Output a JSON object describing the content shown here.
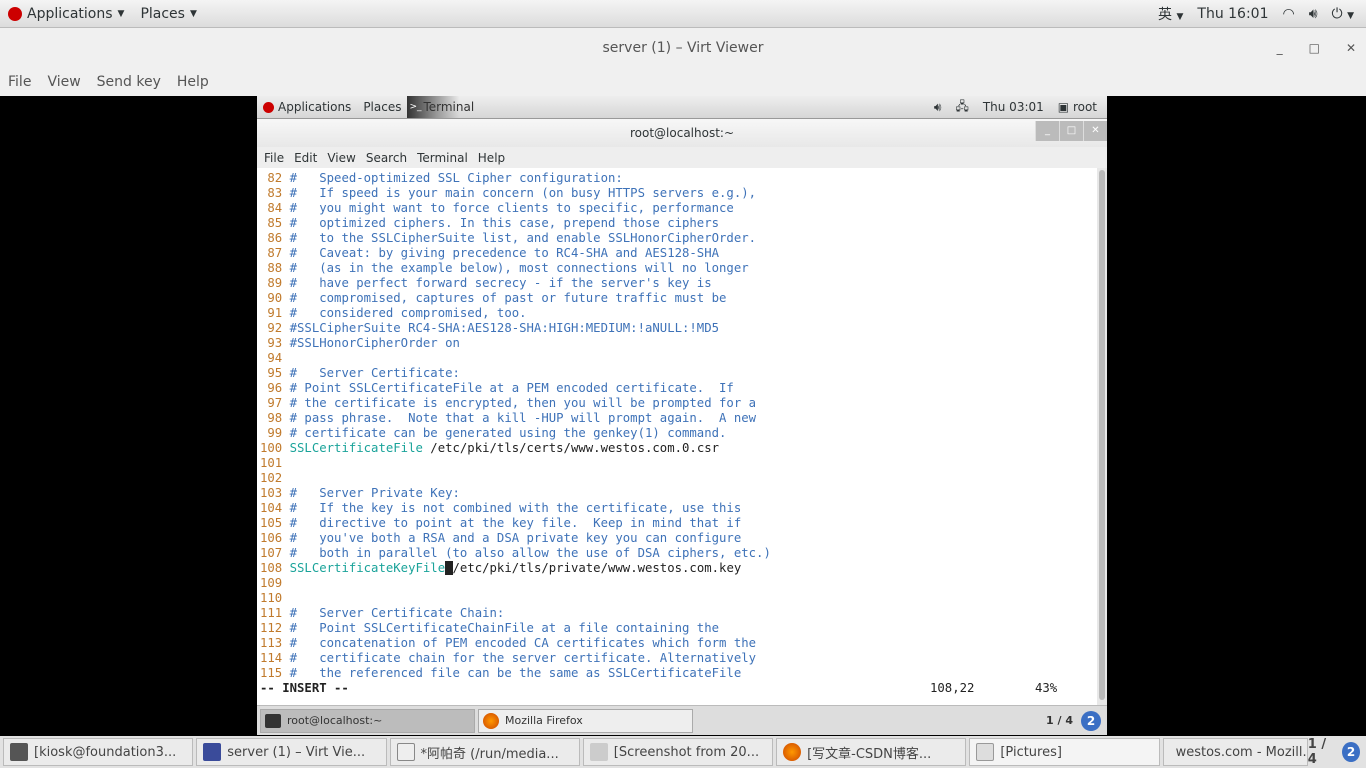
{
  "host_topbar": {
    "applications": "Applications",
    "places": "Places",
    "input_method": "英",
    "clock": "Thu 16:01"
  },
  "viewer": {
    "title": "server (1) – Virt Viewer",
    "menu": [
      "File",
      "View",
      "Send key",
      "Help"
    ]
  },
  "guest_topbar": {
    "applications": "Applications",
    "places": "Places",
    "terminal": "Terminal",
    "clock": "Thu 03:01",
    "user": "root"
  },
  "terminal": {
    "title": "root@localhost:~",
    "menu": [
      "File",
      "Edit",
      "View",
      "Search",
      "Terminal",
      "Help"
    ]
  },
  "lines": [
    {
      "n": "82",
      "c": "#   Speed-optimized SSL Cipher configuration:"
    },
    {
      "n": "83",
      "c": "#   If speed is your main concern (on busy HTTPS servers e.g.),"
    },
    {
      "n": "84",
      "c": "#   you might want to force clients to specific, performance"
    },
    {
      "n": "85",
      "c": "#   optimized ciphers. In this case, prepend those ciphers"
    },
    {
      "n": "86",
      "c": "#   to the SSLCipherSuite list, and enable SSLHonorCipherOrder."
    },
    {
      "n": "87",
      "c": "#   Caveat: by giving precedence to RC4-SHA and AES128-SHA"
    },
    {
      "n": "88",
      "c": "#   (as in the example below), most connections will no longer"
    },
    {
      "n": "89",
      "c": "#   have perfect forward secrecy - if the server's key is"
    },
    {
      "n": "90",
      "c": "#   compromised, captures of past or future traffic must be"
    },
    {
      "n": "91",
      "c": "#   considered compromised, too."
    },
    {
      "n": "92",
      "c": "#SSLCipherSuite RC4-SHA:AES128-SHA:HIGH:MEDIUM:!aNULL:!MD5"
    },
    {
      "n": "93",
      "c": "#SSLHonorCipherOrder on"
    },
    {
      "n": "94"
    },
    {
      "n": "95",
      "c": "#   Server Certificate:"
    },
    {
      "n": "96",
      "c": "# Point SSLCertificateFile at a PEM encoded certificate.  If"
    },
    {
      "n": "97",
      "c": "# the certificate is encrypted, then you will be prompted for a"
    },
    {
      "n": "98",
      "c": "# pass phrase.  Note that a kill -HUP will prompt again.  A new"
    },
    {
      "n": "99",
      "c": "# certificate can be generated using the genkey(1) command."
    },
    {
      "n": "100",
      "k": "SSLCertificateFile",
      "v": " /etc/pki/tls/certs/www.westos.com.0.csr"
    },
    {
      "n": "101"
    },
    {
      "n": "102"
    },
    {
      "n": "103",
      "c": "#   Server Private Key:"
    },
    {
      "n": "104",
      "c": "#   If the key is not combined with the certificate, use this"
    },
    {
      "n": "105",
      "c": "#   directive to point at the key file.  Keep in mind that if"
    },
    {
      "n": "106",
      "c": "#   you've both a RSA and a DSA private key you can configure"
    },
    {
      "n": "107",
      "c": "#   both in parallel (to also allow the use of DSA ciphers, etc.)"
    },
    {
      "n": "108",
      "k": "SSLCertificateKeyFile",
      "cur": " ",
      "v": "/etc/pki/tls/private/www.westos.com.key"
    },
    {
      "n": "109"
    },
    {
      "n": "110"
    },
    {
      "n": "111",
      "c": "#   Server Certificate Chain:"
    },
    {
      "n": "112",
      "c": "#   Point SSLCertificateChainFile at a file containing the"
    },
    {
      "n": "113",
      "c": "#   concatenation of PEM encoded CA certificates which form the"
    },
    {
      "n": "114",
      "c": "#   certificate chain for the server certificate. Alternatively"
    },
    {
      "n": "115",
      "c": "#   the referenced file can be the same as SSLCertificateFile"
    }
  ],
  "status": {
    "mode": "-- INSERT --",
    "position": "108,22",
    "percent": "43%"
  },
  "guest_taskbar": {
    "items": [
      "root@localhost:~",
      "Mozilla Firefox"
    ],
    "pager": "1 / 4",
    "badge": "2"
  },
  "host_taskbar": {
    "items": [
      "[kiosk@foundation3...",
      "server (1) – Virt Vie...",
      "*阿帕奇 (/run/media...",
      "[Screenshot from 20...",
      "[写文章-CSDN博客...",
      "[Pictures]",
      "westos.com - Mozill..."
    ],
    "pager": "1 / 4"
  },
  "colors": {
    "line_number": "#c07a2c",
    "comment": "#3e72b8",
    "directive": "#1aa39a"
  }
}
